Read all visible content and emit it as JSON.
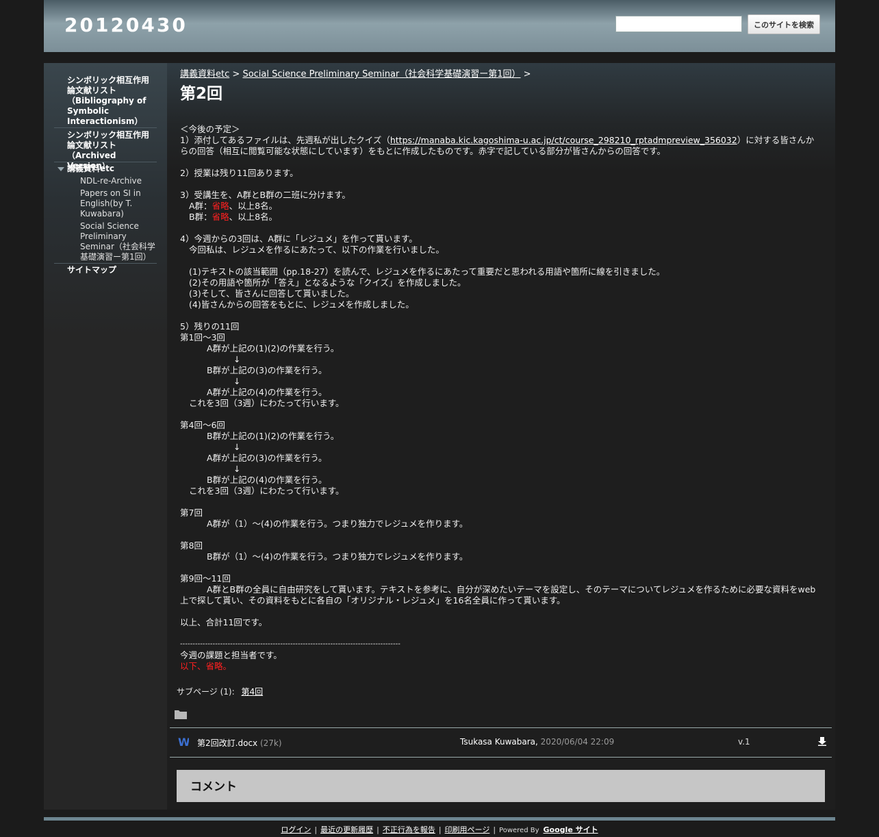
{
  "header": {
    "site_title": "20120430",
    "search_button": "このサイトを検索",
    "search_value": ""
  },
  "sidebar": {
    "items": [
      {
        "label": "シンボリック相互作用論文献リスト（Bibliography of Symbolic Interactionism）"
      },
      {
        "label": "シンボリック相互作用論文献リスト（Archived Version）"
      },
      {
        "label": "講義資料etc",
        "expanded": true,
        "children": [
          {
            "label": "NDL-re-Archive"
          },
          {
            "label": "Papers on SI in English(by T. Kuwabara)"
          },
          {
            "label": "Social Science Preliminary Seminar（社会科学基礎演習ー第1回）"
          }
        ]
      },
      {
        "label": "サイトマップ"
      }
    ]
  },
  "breadcrumb": {
    "root": "講義資料etc",
    "sep": ">",
    "parent": "Social Science Preliminary Seminar（社会科学基礎演習ー第1回）"
  },
  "page": {
    "title": "第2回",
    "lines": {
      "l1": "＜今後の予定＞",
      "l2a": "1）添付してあるファイルは、先週私が出したクイズ（",
      "l2link": "https://manaba.kic.kagoshima-u.ac.jp/ct/course_298210_rptadmpreview_356032",
      "l2b": "）に対する皆さんからの回答（相互に閲覧可能な状態にしています）をもとに作成したものです。赤字で記している部分が皆さんからの回答です。",
      "l3": "2）授業は残り11回あります。",
      "l4": "3）受講生を、A群とB群の二班に分けます。",
      "l5a": "A群：",
      "l5red": "省略",
      "l5b": "、以上8名。",
      "l6a": "B群：",
      "l6red": "省略",
      "l6b": "、以上8名。",
      "l7": "4）今週からの3回は、A群に「レジュメ」を作って貰います。",
      "l8": "今回私は、レジュメを作るにあたって、以下の作業を行いました。",
      "l9": "(1)テキストの該当範囲（pp.18-27）を読んで、レジュメを作るにあたって重要だと思われる用語や箇所に線を引きました。",
      "l10": "(2)その用語や箇所が「答え」となるような「クイズ」を作成しました。",
      "l11": "(3)そして、皆さんに回答して貰いました。",
      "l12": "(4)皆さんからの回答をもとに、レジュメを作成しました。",
      "l13": "5）残りの11回",
      "l14": "第1回～3回",
      "l15": "A群が上記の(1)(2)の作業を行う。",
      "arrow": "↓",
      "l16": "B群が上記の(3)の作業を行う。",
      "l17": "A群が上記の(4)の作業を行う。",
      "l18": "これを3回（3週）にわたって行います。",
      "l19": "第4回～6回",
      "l20": "B群が上記の(1)(2)の作業を行う。",
      "l21": "A群が上記の(3)の作業を行う。",
      "l22": "B群が上記の(4)の作業を行う。",
      "l23": "第7回",
      "l24": "A群が（1）～(4)の作業を行う。つまり独力でレジュメを作ります。",
      "l25": "第8回",
      "l26": "B群が（1）～(4)の作業を行う。つまり独力でレジュメを作ります。",
      "l27": "第9回～11回",
      "l28": "A群とB群の全員に自由研究をして貰います。テキストを参考に、自分が深めたいテーマを設定し、そのテーマについてレジュメを作るために必要な資料をweb上で探して貰い、その資料をもとに各自の「オリジナル・レジュメ」を16名全員に作って貰います。",
      "l29": "以上、合計11回です。",
      "dashes": "----------------------------------------------------------------------------------------",
      "l30": "今週の課題と担当者です。",
      "l31": "以下、省略。"
    }
  },
  "subpages": {
    "label": "サブページ (1):",
    "link": "第4回"
  },
  "attachments": [
    {
      "icon": "word-doc-icon",
      "name": "第2回改訂.docx",
      "size": "(27k)",
      "author": "Tsukasa Kuwabara,",
      "date": "2020/06/04 22:09",
      "version": "v.1"
    }
  ],
  "comments": {
    "title": "コメント"
  },
  "footer": {
    "login": "ログイン",
    "history": "最近の更新履歴",
    "report": "不正行為を報告",
    "print": "印刷用ページ",
    "powered": "Powered By",
    "google_sites": "Google サイト"
  },
  "colors": {
    "accent_red": "#ff2020",
    "header": "#8ea2aa",
    "background": "#1b1b1b"
  }
}
